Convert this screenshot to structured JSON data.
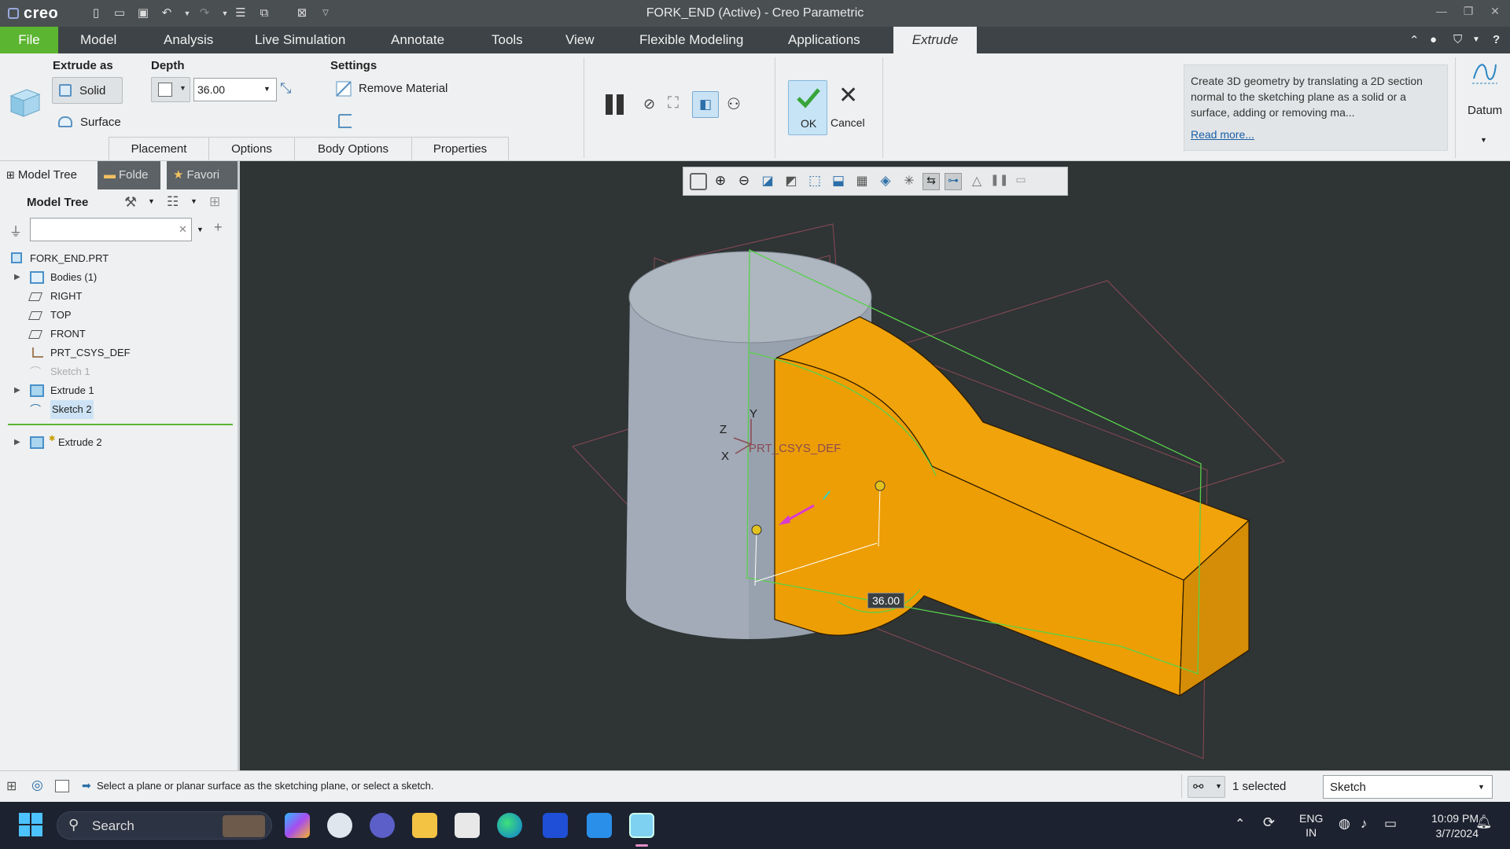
{
  "window": {
    "app_logo": "creo",
    "title": "FORK_END (Active) - Creo Parametric"
  },
  "ribbon_tabs": [
    {
      "label": "File"
    },
    {
      "label": "Model"
    },
    {
      "label": "Analysis"
    },
    {
      "label": "Live Simulation"
    },
    {
      "label": "Annotate"
    },
    {
      "label": "Tools"
    },
    {
      "label": "View"
    },
    {
      "label": "Flexible Modeling"
    },
    {
      "label": "Applications"
    },
    {
      "label": "Extrude"
    }
  ],
  "ribbon": {
    "extrude_as_label": "Extrude as",
    "solid_label": "Solid",
    "surface_label": "Surface",
    "depth_label": "Depth",
    "depth_value": "36.00",
    "settings_label": "Settings",
    "remove_material_label": "Remove Material",
    "ok_label": "OK",
    "cancel_label": "Cancel",
    "help_text": "Create 3D geometry by translating a 2D section normal to the sketching plane as a solid or a surface, adding or removing ma...",
    "read_more": "Read more...",
    "datum_label": "Datum",
    "sub_tabs": [
      "Placement",
      "Options",
      "Body Options",
      "Properties"
    ]
  },
  "left_panel": {
    "tabs": [
      "Model Tree",
      "Folde",
      "Favori"
    ],
    "header": "Model Tree",
    "search_placeholder": "",
    "tree": [
      {
        "label": "FORK_END.PRT",
        "icon": "part-icon"
      },
      {
        "label": "Bodies (1)",
        "icon": "bodies-icon"
      },
      {
        "label": "RIGHT",
        "icon": "datum-plane-icon"
      },
      {
        "label": "TOP",
        "icon": "datum-plane-icon"
      },
      {
        "label": "FRONT",
        "icon": "datum-plane-icon"
      },
      {
        "label": "PRT_CSYS_DEF",
        "icon": "csys-icon"
      },
      {
        "label": "Sketch 1",
        "icon": "sketch-icon"
      },
      {
        "label": "Extrude 1",
        "icon": "extrude-icon"
      },
      {
        "label": "Sketch 2",
        "icon": "sketch-icon"
      },
      {
        "label": "Extrude 2",
        "icon": "extrude-icon"
      }
    ]
  },
  "graphics": {
    "csys_label": "PRT_CSYS_DEF",
    "axis_y": "Y",
    "axis_z": "Z",
    "axis_x": "X",
    "dimension": "36.00",
    "colors": {
      "body": "#f0a20a",
      "cylinder": "#98a2ae",
      "sketch": "#57d14a",
      "background": "#2f3435"
    }
  },
  "status": {
    "message": "Select a plane or planar surface as the sketching plane, or select a sketch.",
    "selected": "1 selected",
    "filter": "Sketch"
  },
  "taskbar": {
    "search": "Search",
    "lang_top": "ENG",
    "lang_bottom": "IN",
    "time": "10:09 PM",
    "date": "3/7/2024"
  }
}
